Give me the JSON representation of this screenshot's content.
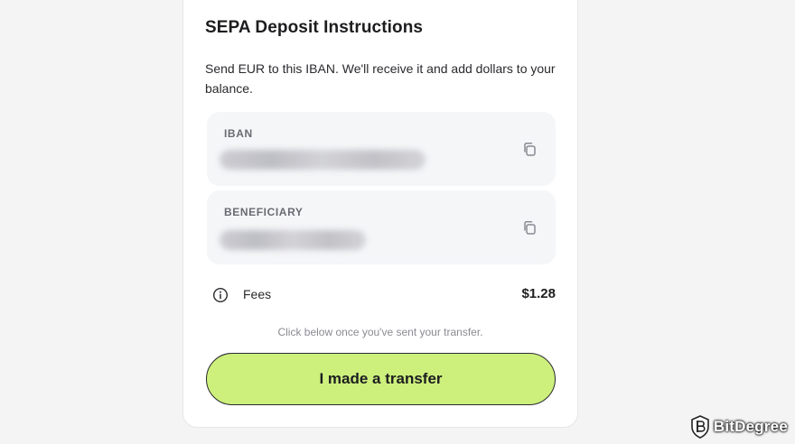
{
  "deposit": {
    "title": "SEPA Deposit Instructions",
    "description": "Send EUR to this IBAN. We'll receive it and add dollars to your balance.",
    "fields": [
      {
        "label": "IBAN",
        "value_redacted": true,
        "action_icon": "copy-icon"
      },
      {
        "label": "BENEFICIARY",
        "value_redacted": true,
        "action_icon": "copy-icon"
      }
    ],
    "fees": {
      "icon": "info-icon",
      "label": "Fees",
      "value": "$1.28"
    },
    "hint": "Click below once you've sent your transfer.",
    "primary_button_label": "I made a transfer"
  },
  "watermark": {
    "text": "BitDegree"
  },
  "colors": {
    "background": "#f4f4f5",
    "card": "#ffffff",
    "field_background": "#f5f6f8",
    "button_fill": "#cdf07d",
    "button_border": "#2a2a2e"
  }
}
